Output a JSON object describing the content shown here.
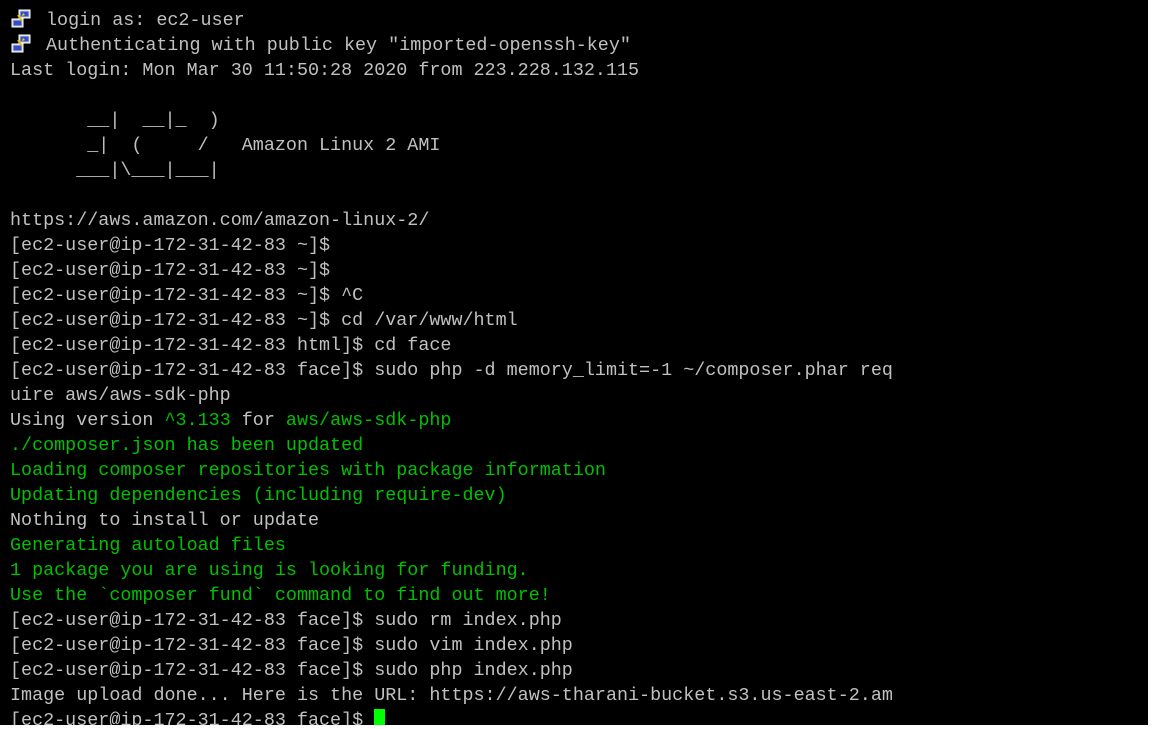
{
  "terminal": {
    "colors": {
      "background": "#000000",
      "text": "#c0c0c0",
      "green": "#00c000",
      "cursor": "#00ff00"
    },
    "icon": "putty-icon",
    "login_line": "login as: ec2-user",
    "auth_line": "Authenticating with public key \"imported-openssh-key\"",
    "last_login": "Last login: Mon Mar 30 11:50:28 2020 from 223.228.132.115",
    "banner": {
      "art1": "       __|  __|_  )",
      "art2": "       _|  (     /   ",
      "label": "Amazon Linux 2 AMI",
      "art3": "      ___|\\___|___|"
    },
    "url_line": "https://aws.amazon.com/amazon-linux-2/",
    "cmd1": "[ec2-user@ip-172-31-42-83 ~]$",
    "cmd2": "[ec2-user@ip-172-31-42-83 ~]$",
    "cmd3": "[ec2-user@ip-172-31-42-83 ~]$ ^C",
    "cmd4": "[ec2-user@ip-172-31-42-83 ~]$ cd /var/www/html",
    "cmd5": "[ec2-user@ip-172-31-42-83 html]$ cd face",
    "cmd6a": "[ec2-user@ip-172-31-42-83 face]$ sudo php -d memory_limit=-1 ~/composer.phar req",
    "cmd6b": "uire aws/aws-sdk-php",
    "using": {
      "p1": "Using version ",
      "version": "^3.133",
      "p2": " for ",
      "pkg": "aws/aws-sdk-php"
    },
    "out1": "./composer.json has been updated",
    "out2": "Loading composer repositories with package information",
    "out3": "Updating dependencies (including require-dev)",
    "out4": "Nothing to install or update",
    "out5": "Generating autoload files",
    "out6": "1 package you are using is looking for funding.",
    "out7": "Use the `composer fund` command to find out more!",
    "cmd7": "[ec2-user@ip-172-31-42-83 face]$ sudo rm index.php",
    "cmd8": "[ec2-user@ip-172-31-42-83 face]$ sudo vim index.php",
    "cmd9": "[ec2-user@ip-172-31-42-83 face]$ sudo php index.php",
    "upload_line": "Image upload done... Here is the URL: https://aws-tharani-bucket.s3.us-east-2.am",
    "prompt": "[ec2-user@ip-172-31-42-83 face]$ "
  }
}
